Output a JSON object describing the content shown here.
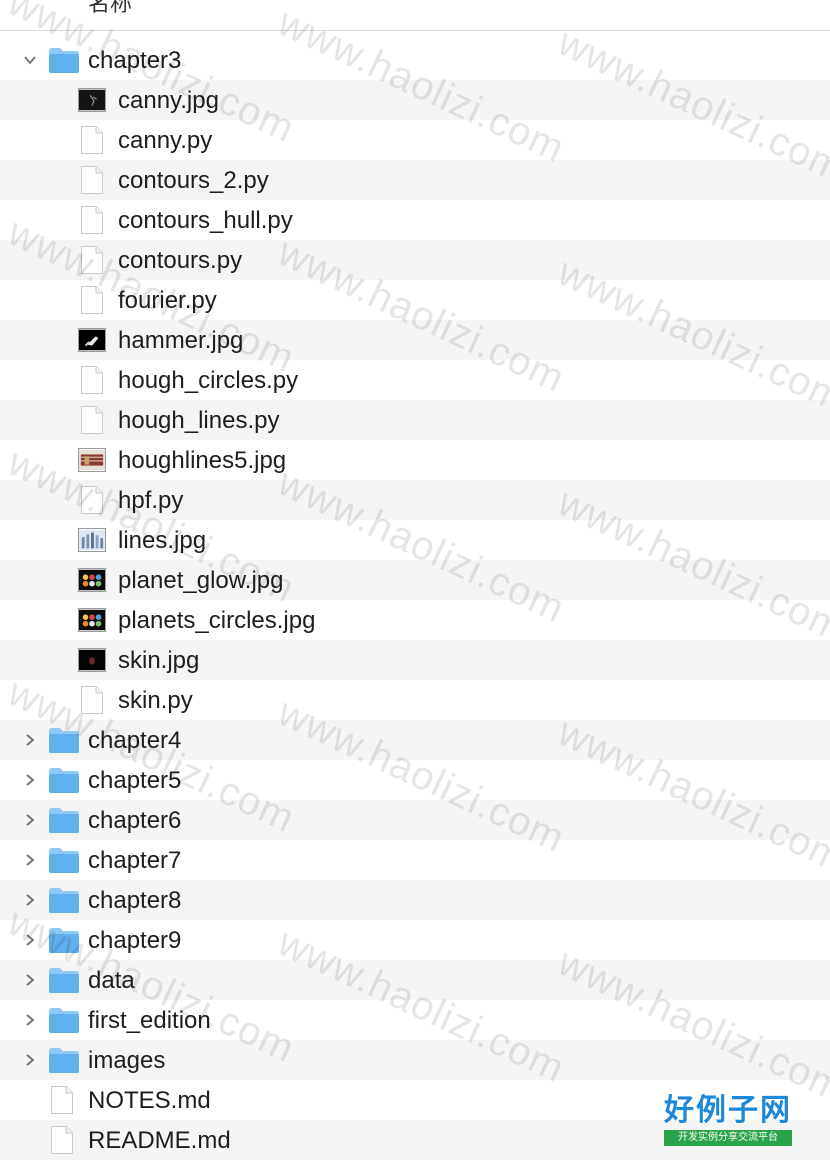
{
  "header": {
    "name_column": "名称"
  },
  "rows": [
    {
      "label": "chapter3",
      "kind": "folder",
      "disclosure": "expanded",
      "depth": 0
    },
    {
      "label": "canny.jpg",
      "kind": "image",
      "thumb": "canny-thumb",
      "depth": 1
    },
    {
      "label": "canny.py",
      "kind": "file",
      "depth": 1
    },
    {
      "label": "contours_2.py",
      "kind": "file",
      "depth": 1
    },
    {
      "label": "contours_hull.py",
      "kind": "file",
      "depth": 1
    },
    {
      "label": "contours.py",
      "kind": "file",
      "depth": 1
    },
    {
      "label": "fourier.py",
      "kind": "file",
      "depth": 1
    },
    {
      "label": "hammer.jpg",
      "kind": "image",
      "thumb": "hammer-thumb",
      "depth": 1
    },
    {
      "label": "hough_circles.py",
      "kind": "file",
      "depth": 1
    },
    {
      "label": "hough_lines.py",
      "kind": "file",
      "depth": 1
    },
    {
      "label": "houghlines5.jpg",
      "kind": "image",
      "thumb": "houghlines-thumb",
      "depth": 1
    },
    {
      "label": "hpf.py",
      "kind": "file",
      "depth": 1
    },
    {
      "label": "lines.jpg",
      "kind": "image",
      "thumb": "lines-thumb",
      "depth": 1
    },
    {
      "label": "planet_glow.jpg",
      "kind": "image",
      "thumb": "planets-thumb",
      "depth": 1
    },
    {
      "label": "planets_circles.jpg",
      "kind": "image",
      "thumb": "planets-thumb",
      "depth": 1
    },
    {
      "label": "skin.jpg",
      "kind": "image",
      "thumb": "skin-thumb",
      "depth": 1
    },
    {
      "label": "skin.py",
      "kind": "file",
      "depth": 1
    },
    {
      "label": "chapter4",
      "kind": "folder",
      "disclosure": "collapsed",
      "depth": 0
    },
    {
      "label": "chapter5",
      "kind": "folder",
      "disclosure": "collapsed",
      "depth": 0
    },
    {
      "label": "chapter6",
      "kind": "folder",
      "disclosure": "collapsed",
      "depth": 0
    },
    {
      "label": "chapter7",
      "kind": "folder",
      "disclosure": "collapsed",
      "depth": 0
    },
    {
      "label": "chapter8",
      "kind": "folder",
      "disclosure": "collapsed",
      "depth": 0
    },
    {
      "label": "chapter9",
      "kind": "folder",
      "disclosure": "collapsed",
      "depth": 0
    },
    {
      "label": "data",
      "kind": "folder",
      "disclosure": "collapsed",
      "depth": 0
    },
    {
      "label": "first_edition",
      "kind": "folder",
      "disclosure": "collapsed",
      "depth": 0
    },
    {
      "label": "images",
      "kind": "folder",
      "disclosure": "collapsed",
      "depth": 0
    },
    {
      "label": "NOTES.md",
      "kind": "file",
      "depth": 0
    },
    {
      "label": "README.md",
      "kind": "file",
      "depth": 0
    }
  ],
  "watermark": "www.haolizi.com",
  "brand": {
    "title": "好例子网",
    "subtitle": "开发实例分享交流平台"
  },
  "colors": {
    "folder": "#5fb0ec",
    "folder_tab": "#8fcaf4",
    "alt_row": "#f4f5f5",
    "brand_blue": "#1e88d8",
    "brand_green": "#2aa34a"
  }
}
